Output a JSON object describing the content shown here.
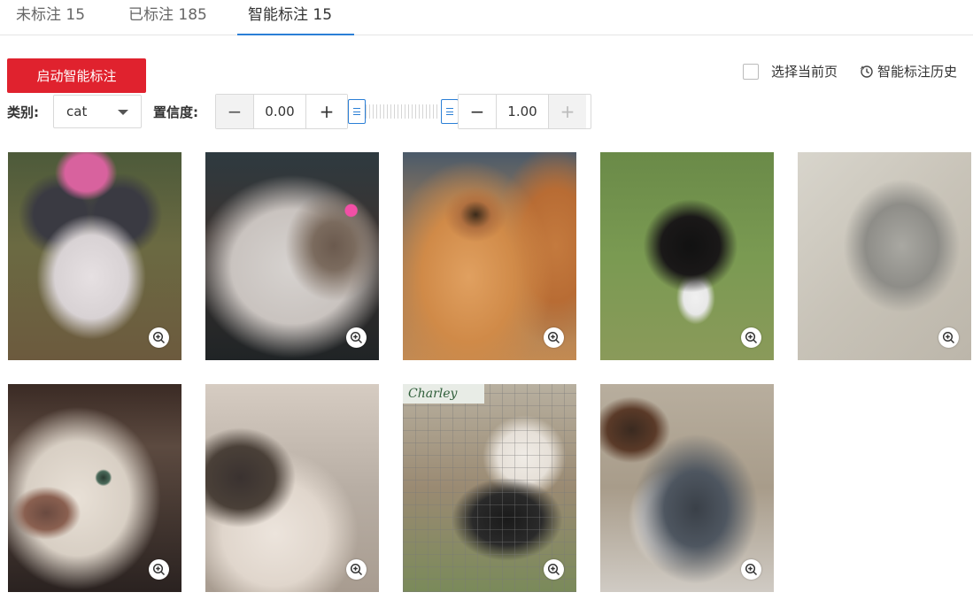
{
  "tabs": [
    {
      "label": "未标注 15",
      "active": false
    },
    {
      "label": "已标注 185",
      "active": false
    },
    {
      "label": "智能标注 15",
      "active": true
    }
  ],
  "toolbar": {
    "start_label": "启动智能标注",
    "select_page_label": "选择当前页",
    "history_label": "智能标注历史"
  },
  "filters": {
    "category_label": "类别:",
    "category_value": "cat",
    "confidence_label": "置信度:",
    "confidence_min": "0.00",
    "confidence_max": "1.00",
    "confidence_range": [
      0.0,
      1.0
    ]
  },
  "images": [
    {
      "icon": "zoom-in-icon"
    },
    {
      "icon": "zoom-in-icon"
    },
    {
      "icon": "zoom-in-icon"
    },
    {
      "icon": "zoom-in-icon"
    },
    {
      "icon": "zoom-in-icon"
    },
    {
      "icon": "zoom-in-icon"
    },
    {
      "icon": "zoom-in-icon"
    },
    {
      "icon": "zoom-in-icon",
      "watermark": "Charley"
    },
    {
      "icon": "zoom-in-icon"
    }
  ],
  "colors": {
    "accent": "#e0222e",
    "tab_underline": "#2b7fd6"
  }
}
